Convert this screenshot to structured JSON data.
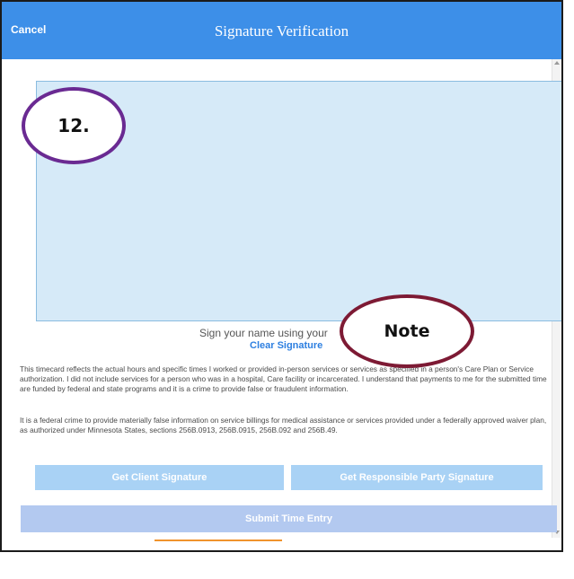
{
  "header": {
    "cancel_label": "Cancel",
    "title": "Signature Verification"
  },
  "signature_area": {
    "instruction": "Sign your name using your",
    "clear_label": "Clear Signature"
  },
  "annotations": {
    "step_label": "12.",
    "note_label": "Note"
  },
  "legal": {
    "paragraph1": "This timecard reflects the actual hours and specific times I worked or provided in-person services or services as specified in a person's Care Plan or Service authorization. I did not include services for a person who was in a hospital, Care facility or incarcerated. I understand that payments to me for the submitted time are funded by federal and state programs and it is a crime to provide false or fraudulent information.",
    "paragraph2": "It is a federal crime to provide materially false information on service billings for medical assistance or services provided under a federally approved waiver plan, as authorized under Minnesota States, sections 256B.0913, 256B.0915, 256B.092 and 256B.49."
  },
  "buttons": {
    "client_signature": "Get Client Signature",
    "responsible_party_signature": "Get Responsible Party Signature",
    "submit": "Submit Time Entry"
  },
  "tabs": [
    {
      "icon": "home-icon"
    },
    {
      "icon": "people-icon",
      "active": true
    },
    {
      "icon": "account-icon"
    },
    {
      "icon": "mail-icon"
    }
  ],
  "colors": {
    "header": "#3d8fe8",
    "signature_pad": "#d6eaf8",
    "button": "#a9d2f5",
    "submit_button": "#b3c9f0",
    "link": "#2d7fe0",
    "active_tab_indicator": "#f0932c",
    "step_circle": "#6a2a92",
    "note_circle": "#7d1a34"
  }
}
